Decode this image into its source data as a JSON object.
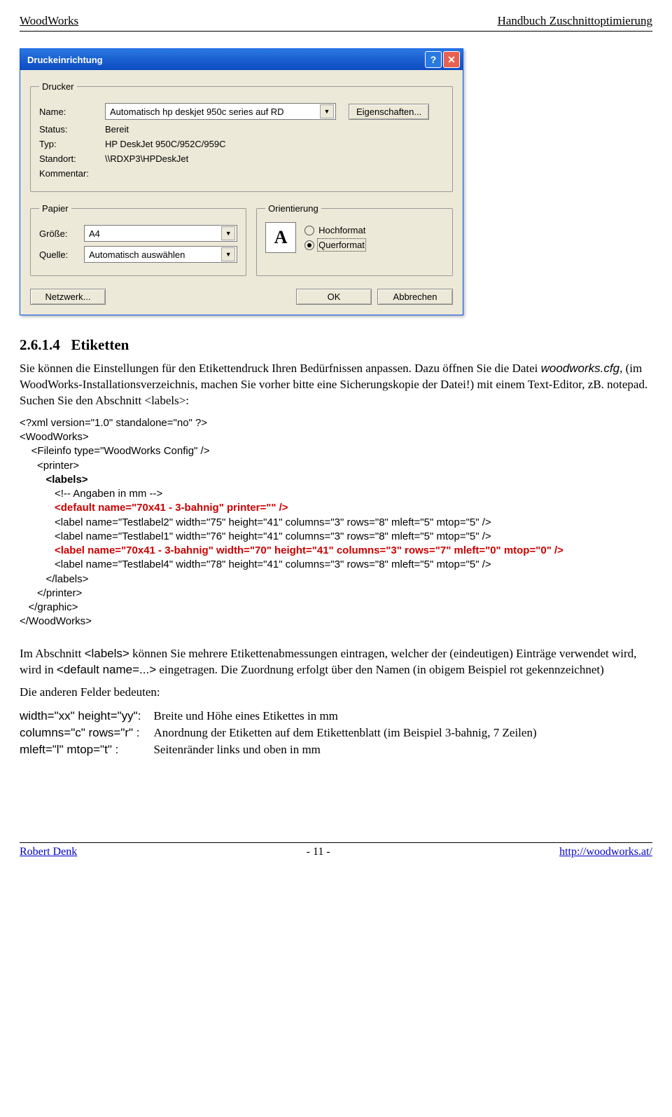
{
  "header": {
    "left": "WoodWorks",
    "right": "Handbuch Zuschnittoptimierung"
  },
  "dialog": {
    "title": "Druckeinrichtung",
    "help_glyph": "?",
    "close_glyph": "✕",
    "printer_legend": "Drucker",
    "name_label": "Name:",
    "name_value": "Automatisch hp deskjet 950c series auf RD",
    "properties_btn": "Eigenschaften...",
    "status_label": "Status:",
    "status_value": "Bereit",
    "type_label": "Typ:",
    "type_value": "HP DeskJet 950C/952C/959C",
    "location_label": "Standort:",
    "location_value": "\\\\RDXP3\\HPDeskJet",
    "comment_label": "Kommentar:",
    "comment_value": "",
    "paper_legend": "Papier",
    "size_label": "Größe:",
    "size_value": "A4",
    "source_label": "Quelle:",
    "source_value": "Automatisch auswählen",
    "orientation_legend": "Orientierung",
    "orient_icon_glyph": "A",
    "portrait_label": "Hochformat",
    "landscape_label": "Querformat",
    "network_btn": "Netzwerk...",
    "ok_btn": "OK",
    "cancel_btn": "Abbrechen"
  },
  "section": {
    "number": "2.6.1.4",
    "title": "Etiketten"
  },
  "para1_a": "Sie können die Einstellungen für den Etikettendruck Ihren Bedürfnissen anpassen. Dazu öffnen Sie die Datei ",
  "para1_file": "woodworks.cfg",
  "para1_b": ", (im WoodWorks-Installationsverzeichnis, machen Sie vorher bitte eine Sicherungskopie der Datei!) mit einem Text-Editor, zB. notepad. Suchen Sie den Abschnitt <labels>:",
  "xml": {
    "l1": "<?xml version=\"1.0\" standalone=\"no\" ?>",
    "l2": "<WoodWorks>",
    "l3": "    <Fileinfo type=\"WoodWorks Config\" />",
    "l4": "      <printer>",
    "l5": "         <labels>",
    "l6": "            <!-- Angaben in mm -->",
    "l7": "            <default name=\"70x41 - 3-bahnig\" printer=\"\" />",
    "l8": "            <label name=\"Testlabel2\" width=\"75\" height=\"41\" columns=\"3\" rows=\"8\" mleft=\"5\" mtop=\"5\" />",
    "l9": "            <label name=\"Testlabel1\" width=\"76\" height=\"41\" columns=\"3\" rows=\"8\" mleft=\"5\" mtop=\"5\" />",
    "l10": "            <label name=\"70x41 - 3-bahnig\" width=\"70\" height=\"41\" columns=\"3\" rows=\"7\" mleft=\"0\" mtop=\"0\" />",
    "l11": "            <label name=\"Testlabel4\" width=\"78\" height=\"41\" columns=\"3\" rows=\"8\" mleft=\"5\" mtop=\"5\" />",
    "l12": "         </labels>",
    "l13": "      </printer>",
    "l14": "   </graphic>",
    "l15": "</WoodWorks>"
  },
  "para2_a": "Im Abschnitt ",
  "para2_labels": "<labels>",
  "para2_b": " können Sie mehrere Etikettenabmessungen eintragen, welcher der (eindeutigen) Einträge verwendet wird, wird in ",
  "para2_default": "<default name=...>",
  "para2_c": " eingetragen. Die Zuordnung erfolgt über den Namen (in obigem Beispiel rot gekennzeichnet)",
  "para3": "Die anderen Felder bedeuten:",
  "defs": {
    "k1": "width=\"xx\" height=\"yy\":",
    "v1": "Breite und Höhe eines Etikettes in mm",
    "k2": "columns=\"c\" rows=\"r\" :",
    "v2": "Anordnung der Etiketten auf dem Etikettenblatt (im Beispiel 3-bahnig, 7 Zeilen)",
    "k3": "mleft=\"l\" mtop=\"t\" :",
    "v3": "Seitenränder links und oben in mm"
  },
  "footer": {
    "author": "Robert Denk",
    "page": "- 11 -",
    "url": "http://woodworks.at/"
  }
}
